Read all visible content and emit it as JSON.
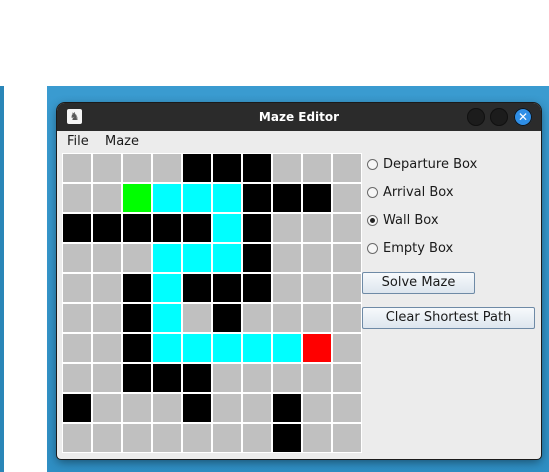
{
  "window": {
    "title": "Maze Editor",
    "close_glyph": "✕",
    "app_icon": "maze-app-icon"
  },
  "menubar": {
    "items": [
      "File",
      "Maze"
    ]
  },
  "colors": {
    "wall": "#000000",
    "empty": "#c0c0c0",
    "departure": "#00ff00",
    "arrival": "#ff0000",
    "path": "#00ffff",
    "grid_line": "#ffffff",
    "titlebar": "#2b2b2b",
    "close_button": "#2e8ee6"
  },
  "maze": {
    "rows": 10,
    "cols": 10,
    "legend": {
      "E": "empty",
      "W": "wall",
      "D": "departure",
      "A": "arrival",
      "P": "path"
    },
    "cells": [
      "EEEEWWWEEE",
      "EEDPPPWWWE",
      "WWWWWPWEEE",
      "EEEPPPWEEE",
      "EEWPWWWEEE",
      "EEWPEWEEEE",
      "EEWPPPPPAE",
      "EEWWWEEEEE",
      "WEEEWEEWEE",
      "EEEEEEEWEE"
    ]
  },
  "controls": {
    "radios": [
      {
        "label": "Departure Box",
        "checked": false
      },
      {
        "label": "Arrival Box",
        "checked": false
      },
      {
        "label": "Wall Box",
        "checked": true
      },
      {
        "label": "Empty Box",
        "checked": false
      }
    ],
    "solve_label": "Solve Maze",
    "clear_label": "Clear Shortest Path"
  }
}
